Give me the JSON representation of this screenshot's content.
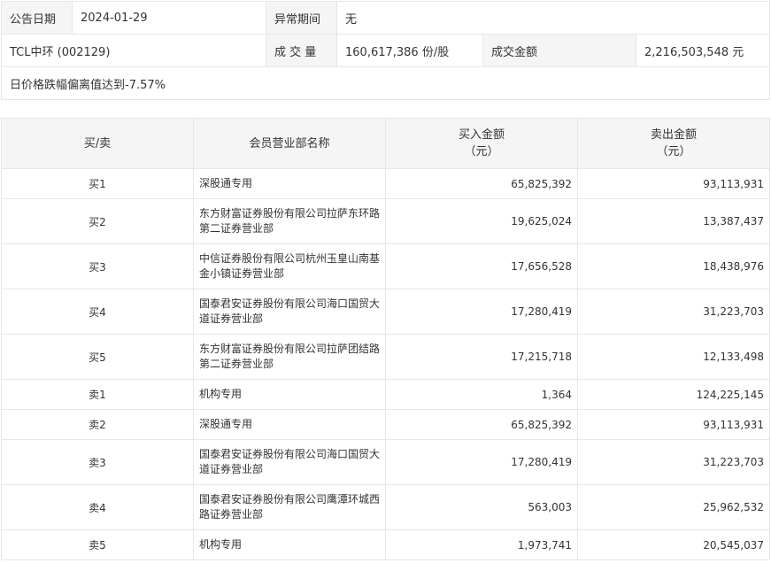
{
  "info": {
    "date_label": "公告日期",
    "date_value": "2024-01-29",
    "period_label": "异常期间",
    "period_value": "无",
    "stock": "TCL中环 (002129)",
    "volume_label": "成 交 量",
    "volume_value": "160,617,386 份/股",
    "amount_label": "成交金额",
    "amount_value": "2,216,503,548 元",
    "remark": "日价格跌幅偏离值达到-7.57%"
  },
  "headers": {
    "dir": "买/卖",
    "name": "会员营业部名称",
    "buy": "买入金额\n（元）",
    "sell": "卖出金额\n（元）"
  },
  "rows": [
    {
      "dir": "买1",
      "name": "深股通专用",
      "buy": "65,825,392",
      "sell": "93,113,931"
    },
    {
      "dir": "买2",
      "name": "东方财富证券股份有限公司拉萨东环路第二证券营业部",
      "buy": "19,625,024",
      "sell": "13,387,437"
    },
    {
      "dir": "买3",
      "name": "中信证券股份有限公司杭州玉皇山南基金小镇证券营业部",
      "buy": "17,656,528",
      "sell": "18,438,976"
    },
    {
      "dir": "买4",
      "name": "国泰君安证券股份有限公司海口国贸大道证券营业部",
      "buy": "17,280,419",
      "sell": "31,223,703"
    },
    {
      "dir": "买5",
      "name": "东方财富证券股份有限公司拉萨团结路第二证券营业部",
      "buy": "17,215,718",
      "sell": "12,133,498"
    },
    {
      "dir": "卖1",
      "name": "机构专用",
      "buy": "1,364",
      "sell": "124,225,145"
    },
    {
      "dir": "卖2",
      "name": "深股通专用",
      "buy": "65,825,392",
      "sell": "93,113,931"
    },
    {
      "dir": "卖3",
      "name": "国泰君安证券股份有限公司海口国贸大道证券营业部",
      "buy": "17,280,419",
      "sell": "31,223,703"
    },
    {
      "dir": "卖4",
      "name": "国泰君安证券股份有限公司鹰潭环城西路证券营业部",
      "buy": "563,003",
      "sell": "25,962,532"
    },
    {
      "dir": "卖5",
      "name": "机构专用",
      "buy": "1,973,741",
      "sell": "20,545,037"
    }
  ]
}
